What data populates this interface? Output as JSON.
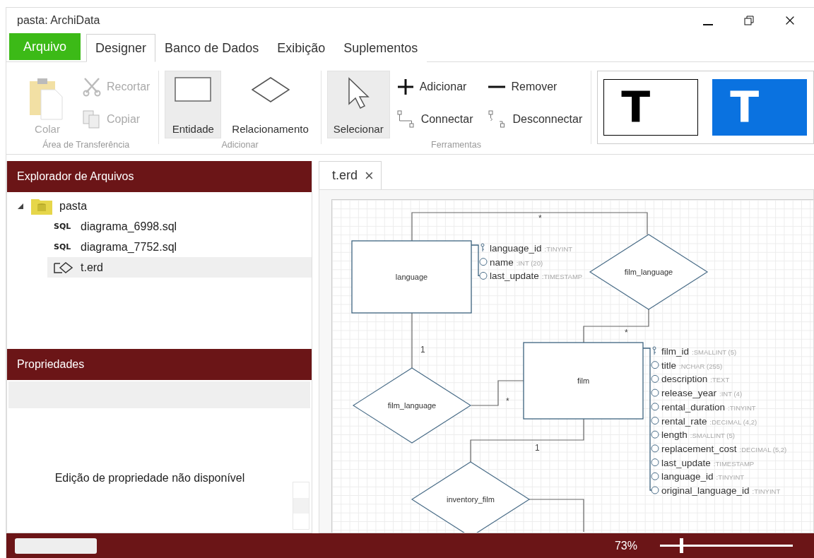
{
  "window": {
    "title": "pasta: ArchiData"
  },
  "menu_tabs": [
    {
      "label": "Arquivo",
      "kind": "file",
      "selected": false
    },
    {
      "label": "Designer",
      "kind": "tab",
      "selected": true
    },
    {
      "label": "Banco de Dados",
      "kind": "tab",
      "selected": false
    },
    {
      "label": "Exibição",
      "kind": "tab",
      "selected": false
    },
    {
      "label": "Suplementos",
      "kind": "tab",
      "selected": false
    }
  ],
  "ribbon": {
    "groups": [
      {
        "caption": "Área de Transferência",
        "items": [
          {
            "label": "Colar",
            "kind": "large",
            "disabled": true,
            "selected": false
          },
          {
            "label": "Recortar",
            "kind": "small",
            "disabled": true
          },
          {
            "label": "Copiar",
            "kind": "small",
            "disabled": true
          }
        ]
      },
      {
        "caption": "Adicionar",
        "items": [
          {
            "label": "Entidade",
            "kind": "large",
            "disabled": false,
            "selected": true
          },
          {
            "label": "Relacionamento",
            "kind": "large",
            "disabled": false,
            "selected": false
          }
        ]
      },
      {
        "caption": "Ferramentas",
        "items": [
          {
            "label": "Selecionar",
            "kind": "large",
            "disabled": false,
            "selected": true
          },
          {
            "label": "Adicionar",
            "kind": "small",
            "disabled": false
          },
          {
            "label": "Connectar",
            "kind": "small",
            "disabled": false
          },
          {
            "label": "Remover",
            "kind": "small",
            "disabled": false
          },
          {
            "label": "Desconnectar",
            "kind": "small",
            "disabled": false
          }
        ]
      }
    ],
    "styles": [
      {
        "glyph": "T",
        "selected": false
      },
      {
        "glyph": "T",
        "selected": true
      }
    ]
  },
  "explorer": {
    "title": "Explorador de Arquivos",
    "tree": [
      {
        "label": "pasta",
        "expanded": true,
        "children": [
          {
            "label": "diagrama_6998.sql",
            "kind": "sql",
            "badge": "SQL",
            "selected": false
          },
          {
            "label": "diagrama_7752.sql",
            "kind": "sql",
            "badge": "SQL",
            "selected": false
          },
          {
            "label": "t.erd",
            "kind": "erd",
            "selected": true
          }
        ]
      }
    ]
  },
  "properties": {
    "title": "Propriedades",
    "message": "Edição de propriedade não disponível"
  },
  "document_tabs": [
    {
      "label": "t.erd",
      "close": "×",
      "selected": true
    }
  ],
  "diagram": {
    "entities": [
      {
        "name": "language",
        "attributes": [
          {
            "name": "language_id",
            "type": ":TINYINT",
            "primary_key": true
          },
          {
            "name": "name",
            "type": ":INT (20)",
            "primary_key": false
          },
          {
            "name": "last_update",
            "type": ":TIMESTAMP",
            "primary_key": false
          }
        ]
      },
      {
        "name": "film",
        "attributes": [
          {
            "name": "film_id",
            "type": ":SMALLINT (5)",
            "primary_key": true
          },
          {
            "name": "title",
            "type": ":NCHAR (255)",
            "primary_key": false
          },
          {
            "name": "description",
            "type": ":TEXT",
            "primary_key": false
          },
          {
            "name": "release_year",
            "type": ":INT (4)",
            "primary_key": false
          },
          {
            "name": "rental_duration",
            "type": ":TINYINT",
            "primary_key": false
          },
          {
            "name": "rental_rate",
            "type": ":DECIMAL (4,2)",
            "primary_key": false
          },
          {
            "name": "length",
            "type": ":SMALLINT (5)",
            "primary_key": false
          },
          {
            "name": "replacement_cost",
            "type": ":DECIMAL (5,2)",
            "primary_key": false
          },
          {
            "name": "last_update",
            "type": ":TIMESTAMP",
            "primary_key": false
          },
          {
            "name": "language_id",
            "type": ":TINYINT",
            "primary_key": false
          },
          {
            "name": "original_language_id",
            "type": ":TINYINT",
            "primary_key": false
          }
        ]
      }
    ],
    "relationships": [
      {
        "name": "film_language"
      },
      {
        "name": "film_language"
      },
      {
        "name": "inventory_film"
      }
    ],
    "cardinalities": [
      "*",
      "*",
      "1",
      "*",
      "1"
    ]
  },
  "status_bar": {
    "zoom": "73%",
    "zoom_slider": {
      "level": 0.16
    }
  }
}
